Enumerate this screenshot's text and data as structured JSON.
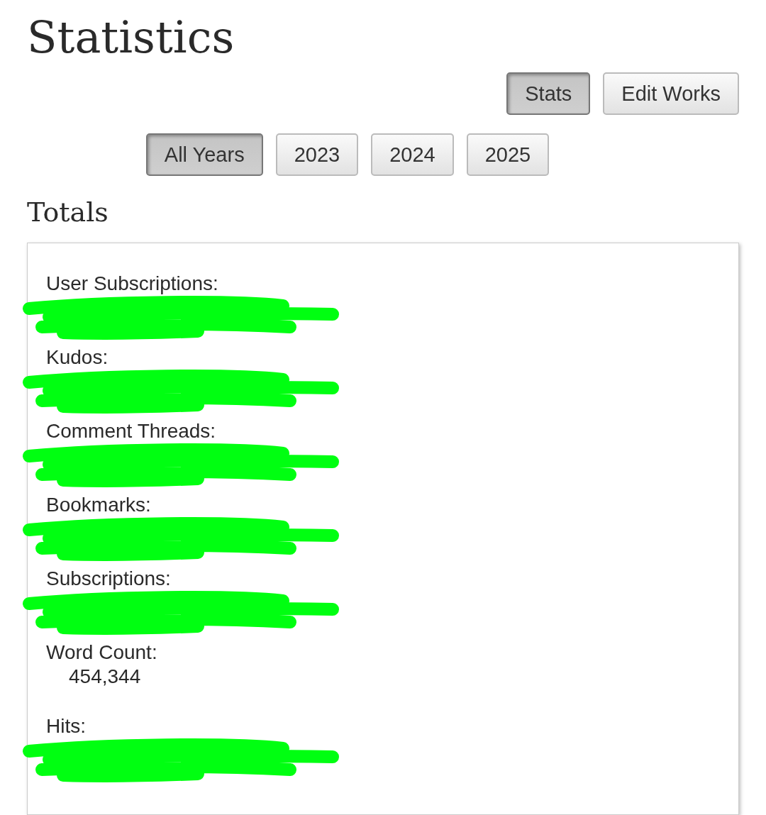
{
  "title": "Statistics",
  "view_buttons": [
    {
      "label": "Stats",
      "selected": true
    },
    {
      "label": "Edit Works",
      "selected": false
    }
  ],
  "year_buttons": [
    {
      "label": "All Years",
      "selected": true
    },
    {
      "label": "2023",
      "selected": false
    },
    {
      "label": "2024",
      "selected": false
    },
    {
      "label": "2025",
      "selected": false
    }
  ],
  "section_title": "Totals",
  "stats": [
    {
      "label": "User Subscriptions:",
      "kind": "redacted"
    },
    {
      "label": "Kudos:",
      "kind": "redacted"
    },
    {
      "label": "Comment Threads:",
      "kind": "redacted"
    },
    {
      "label": "Bookmarks:",
      "kind": "redacted"
    },
    {
      "label": "Subscriptions:",
      "kind": "redacted"
    },
    {
      "label": "Word Count:",
      "kind": "value",
      "value": "454,344"
    },
    {
      "label": "Hits:",
      "kind": "redacted"
    }
  ]
}
